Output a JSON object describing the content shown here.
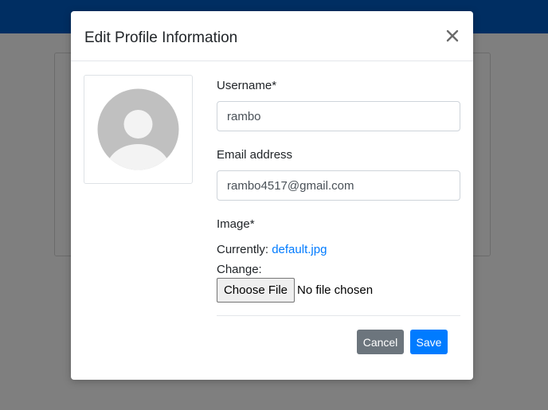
{
  "modal": {
    "title": "Edit Profile Information",
    "close_glyph": "×"
  },
  "avatar": {
    "icon": "user-avatar-placeholder-icon"
  },
  "form": {
    "username": {
      "label": "Username*",
      "value": "rambo"
    },
    "email": {
      "label": "Email address",
      "value": "rambo4517@gmail.com"
    },
    "image": {
      "label": "Image*",
      "currently_label": "Currently:",
      "current_file": "default.jpg",
      "change_label": "Change:",
      "choose_file_label": "Choose File",
      "file_status": "No file chosen"
    }
  },
  "actions": {
    "cancel_label": "Cancel",
    "save_label": "Save"
  },
  "colors": {
    "navbar": "#005cc5",
    "primary": "#007bff",
    "secondary": "#6c757d",
    "link": "#007bff"
  }
}
